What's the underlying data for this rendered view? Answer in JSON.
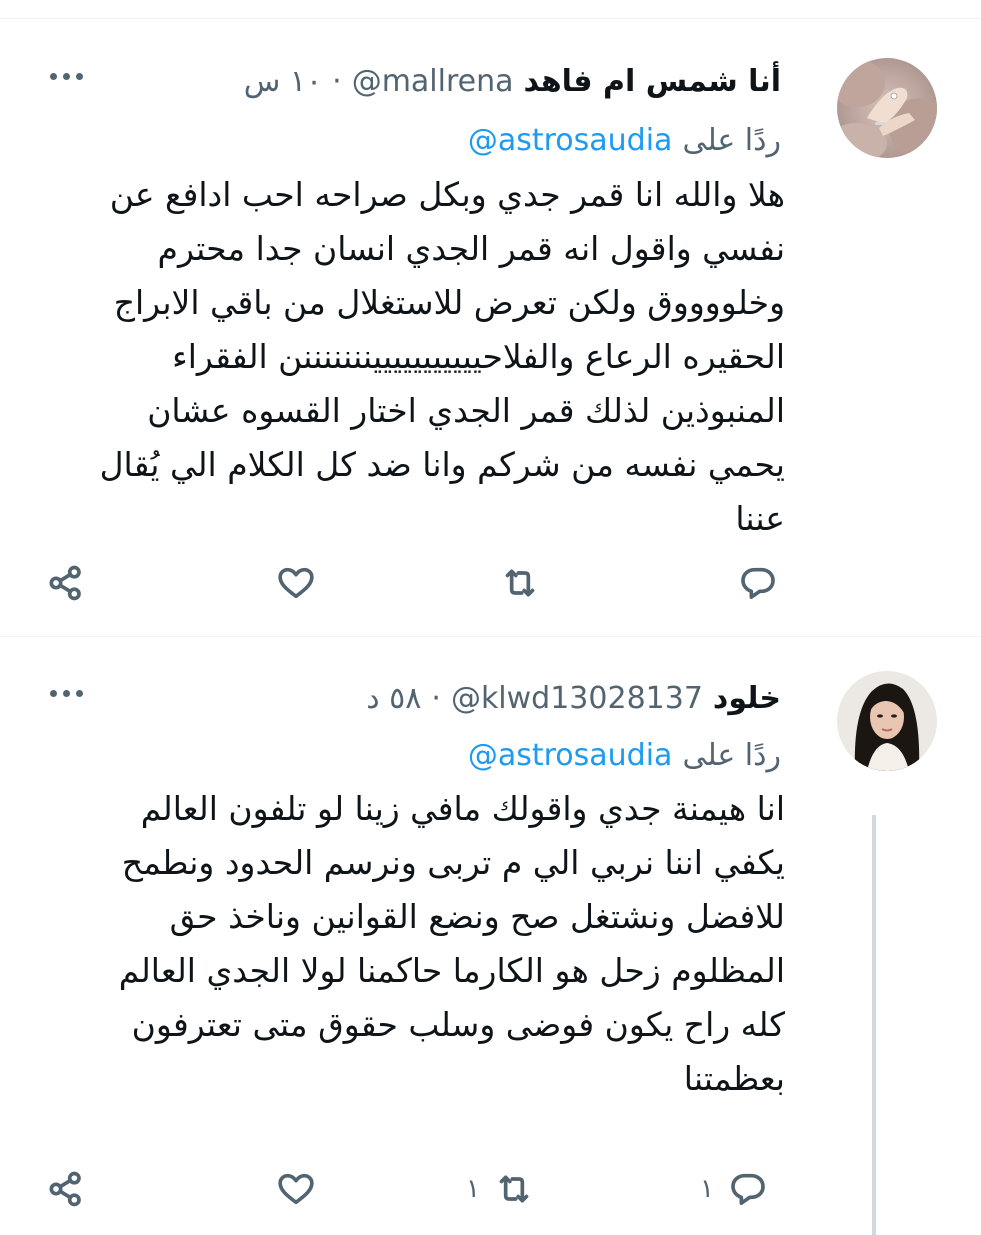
{
  "tweets": [
    {
      "name": "أنا شمس ام فاهد",
      "handle": "@mallrena",
      "separator": "·",
      "time": "١٠ س",
      "replying_label": "ردًا على",
      "replying_to": "@astrosaudia",
      "body_lines": [
        "هلا والله انا قمر جدي وبكل صراحه احب ادافع عن",
        "نفسي واقول انه قمر الجدي انسان جدا محترم",
        "وخلووووق ولكن تعرض للاستغلال من باقي الابراج",
        "الحقيره الرعاع والفلاحييييييييييينننننننن الفقراء",
        "المنبوذين لذلك قمر الجدي اختار القسوه عشان",
        "يحمي نفسه من شركم وانا ضد كل الكلام الي يُقال",
        "عننا"
      ],
      "reply_count": "",
      "retweet_count": "",
      "like_count": "",
      "avatar_icon": "avatar-photo-hands"
    },
    {
      "name": "خلود",
      "handle": "@klwd13028137",
      "separator": "·",
      "time": "٥٨ د",
      "replying_label": "ردًا على",
      "replying_to": "@astrosaudia",
      "body_lines": [
        "انا هيمنة جدي واقولك مافي زينا لو تلفون العالم",
        "يكفي اننا نربي الي م تربى ونرسم الحدود ونطمح",
        "للافضل ونشتغل صح ونضع القوانين وناخذ حق",
        "المظلوم زحل هو الكارما حاكمنا لولا الجدي العالم",
        "كله راح يكون فوضى وسلب حقوق متى تعترفون",
        "بعظمتنا"
      ],
      "reply_count": "١",
      "retweet_count": "١",
      "like_count": "",
      "avatar_icon": "avatar-photo-woman"
    }
  ],
  "icons": {
    "more": "more-dots-icon",
    "reply": "reply-bubble-icon",
    "retweet": "retweet-arrows-icon",
    "like": "heart-icon",
    "share": "share-nodes-icon"
  },
  "colors": {
    "accent": "#1d9bf0",
    "secondary_text": "#536471",
    "divider": "#eff3f4"
  }
}
